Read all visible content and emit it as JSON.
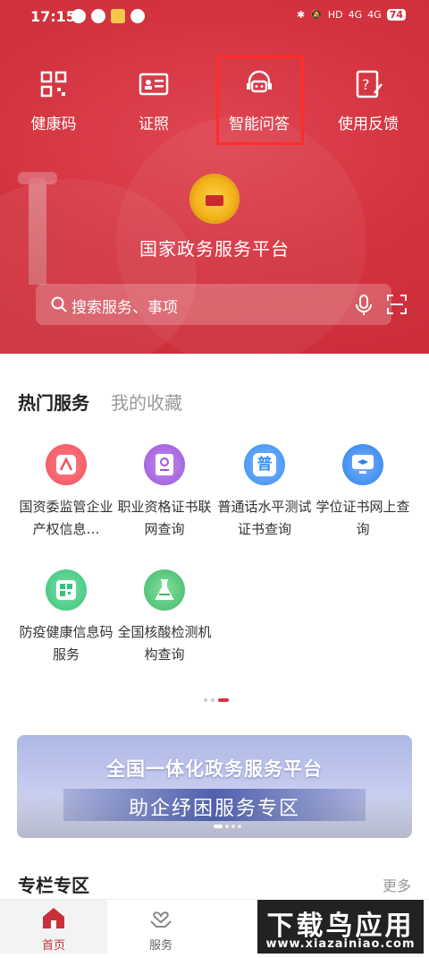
{
  "status_bar": {
    "time": "17:15",
    "battery": "74",
    "network1": "4G",
    "network2": "4G",
    "hd": "HD"
  },
  "quick_actions": [
    {
      "label": "健康码",
      "icon": "qr-code-icon"
    },
    {
      "label": "证照",
      "icon": "id-card-icon"
    },
    {
      "label": "智能问答",
      "icon": "headset-chat-icon"
    },
    {
      "label": "使用反馈",
      "icon": "feedback-icon"
    }
  ],
  "platform_title": "国家政务服务平台",
  "search": {
    "placeholder": "搜索服务、事项"
  },
  "tabs": {
    "hot": "热门服务",
    "favorites": "我的收藏"
  },
  "services": [
    {
      "name": "国资委监管企业产权信息…",
      "color": "#f0505c"
    },
    {
      "name": "职业资格证书联网查询",
      "color": "#9b57d8"
    },
    {
      "name": "普通话水平测试证书查询",
      "color": "#3b8ff0",
      "glyph": "普"
    },
    {
      "name": "学位证书网上查询",
      "color": "#2f83e8"
    },
    {
      "name": "防疫健康信息码服务",
      "color": "#37c27a"
    },
    {
      "name": "全国核酸检测机构查询",
      "color": "#3fb86a"
    }
  ],
  "banner": {
    "line1": "全国一体化政务服务平台",
    "line2": "助企纾困服务专区"
  },
  "column": {
    "title": "专栏专区",
    "more": "更多"
  },
  "bottom_nav": {
    "home": "首页",
    "service": "服务"
  },
  "watermark": {
    "title": "下载鸟应用",
    "url": "www.xiazainiao.com"
  }
}
